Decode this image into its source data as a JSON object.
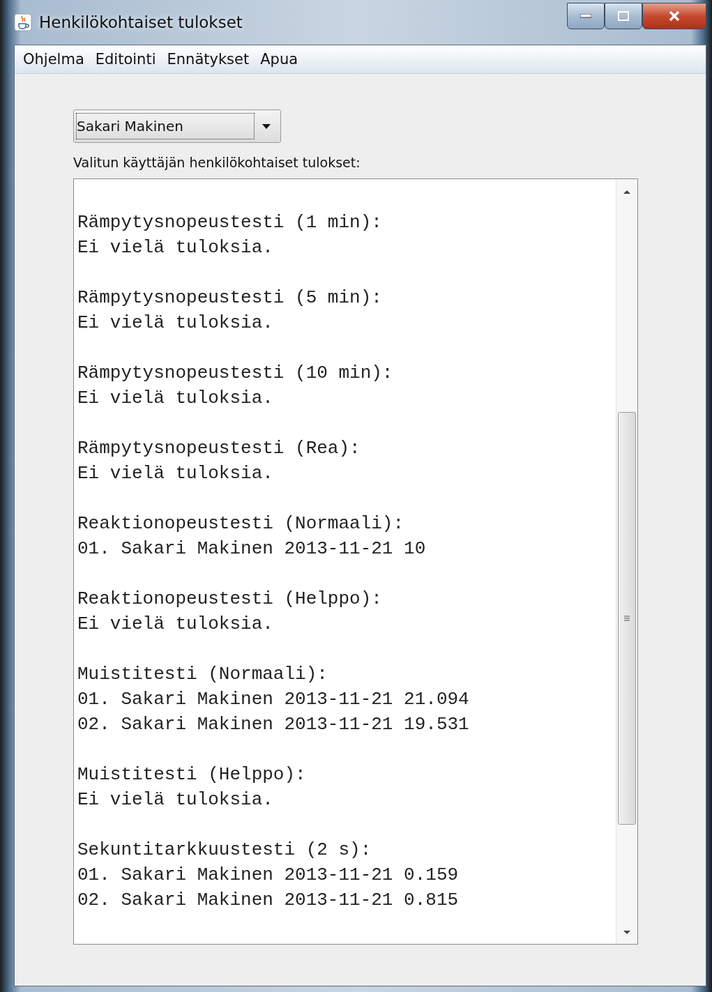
{
  "window": {
    "title": "Henkilökohtaiset tulokset"
  },
  "menu": [
    "Ohjelma",
    "Editointi",
    "Ennätykset",
    "Apua"
  ],
  "user_select": {
    "value": "Sakari Makinen"
  },
  "results_label": "Valitun käyttäjän henkilökohtaiset tulokset:",
  "results": [
    {
      "heading": "Rämpytysnopeustesti (1 min):",
      "lines": [
        "Ei vielä tuloksia."
      ]
    },
    {
      "heading": "Rämpytysnopeustesti (5 min):",
      "lines": [
        "Ei vielä tuloksia."
      ]
    },
    {
      "heading": "Rämpytysnopeustesti (10 min):",
      "lines": [
        "Ei vielä tuloksia."
      ]
    },
    {
      "heading": "Rämpytysnopeustesti (Rea):",
      "lines": [
        "Ei vielä tuloksia."
      ]
    },
    {
      "heading": "Reaktionopeustesti (Normaali):",
      "lines": [
        "01. Sakari Makinen 2013-11-21 10"
      ]
    },
    {
      "heading": "Reaktionopeustesti (Helppo):",
      "lines": [
        "Ei vielä tuloksia."
      ]
    },
    {
      "heading": "Muistitesti (Normaali):",
      "lines": [
        "01. Sakari Makinen 2013-11-21 21.094",
        "02. Sakari Makinen 2013-11-21 19.531"
      ]
    },
    {
      "heading": "Muistitesti (Helppo):",
      "lines": [
        "Ei vielä tuloksia."
      ]
    },
    {
      "heading": "Sekuntitarkkuustesti (2 s):",
      "lines": [
        "01. Sakari Makinen 2013-11-21 0.159",
        "02. Sakari Makinen 2013-11-21 0.815"
      ]
    }
  ]
}
